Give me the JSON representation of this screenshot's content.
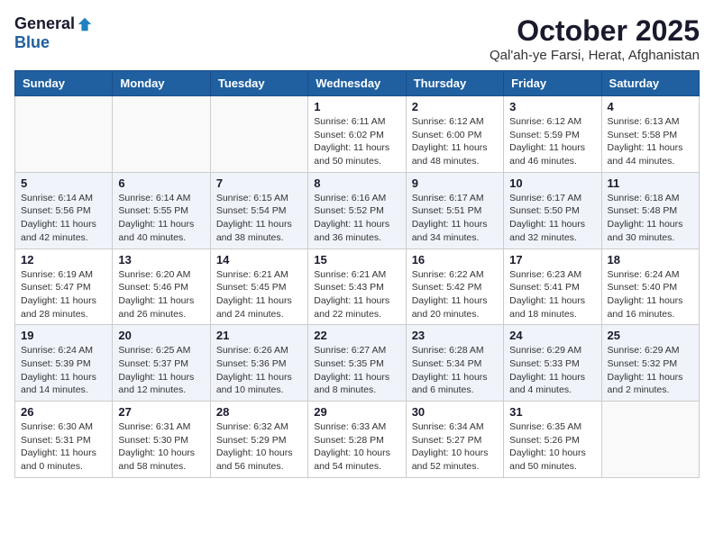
{
  "logo": {
    "general": "General",
    "blue": "Blue"
  },
  "title": "October 2025",
  "location": "Qal'ah-ye Farsi, Herat, Afghanistan",
  "weekdays": [
    "Sunday",
    "Monday",
    "Tuesday",
    "Wednesday",
    "Thursday",
    "Friday",
    "Saturday"
  ],
  "weeks": [
    [
      {
        "day": "",
        "info": ""
      },
      {
        "day": "",
        "info": ""
      },
      {
        "day": "",
        "info": ""
      },
      {
        "day": "1",
        "info": "Sunrise: 6:11 AM\nSunset: 6:02 PM\nDaylight: 11 hours\nand 50 minutes."
      },
      {
        "day": "2",
        "info": "Sunrise: 6:12 AM\nSunset: 6:00 PM\nDaylight: 11 hours\nand 48 minutes."
      },
      {
        "day": "3",
        "info": "Sunrise: 6:12 AM\nSunset: 5:59 PM\nDaylight: 11 hours\nand 46 minutes."
      },
      {
        "day": "4",
        "info": "Sunrise: 6:13 AM\nSunset: 5:58 PM\nDaylight: 11 hours\nand 44 minutes."
      }
    ],
    [
      {
        "day": "5",
        "info": "Sunrise: 6:14 AM\nSunset: 5:56 PM\nDaylight: 11 hours\nand 42 minutes."
      },
      {
        "day": "6",
        "info": "Sunrise: 6:14 AM\nSunset: 5:55 PM\nDaylight: 11 hours\nand 40 minutes."
      },
      {
        "day": "7",
        "info": "Sunrise: 6:15 AM\nSunset: 5:54 PM\nDaylight: 11 hours\nand 38 minutes."
      },
      {
        "day": "8",
        "info": "Sunrise: 6:16 AM\nSunset: 5:52 PM\nDaylight: 11 hours\nand 36 minutes."
      },
      {
        "day": "9",
        "info": "Sunrise: 6:17 AM\nSunset: 5:51 PM\nDaylight: 11 hours\nand 34 minutes."
      },
      {
        "day": "10",
        "info": "Sunrise: 6:17 AM\nSunset: 5:50 PM\nDaylight: 11 hours\nand 32 minutes."
      },
      {
        "day": "11",
        "info": "Sunrise: 6:18 AM\nSunset: 5:48 PM\nDaylight: 11 hours\nand 30 minutes."
      }
    ],
    [
      {
        "day": "12",
        "info": "Sunrise: 6:19 AM\nSunset: 5:47 PM\nDaylight: 11 hours\nand 28 minutes."
      },
      {
        "day": "13",
        "info": "Sunrise: 6:20 AM\nSunset: 5:46 PM\nDaylight: 11 hours\nand 26 minutes."
      },
      {
        "day": "14",
        "info": "Sunrise: 6:21 AM\nSunset: 5:45 PM\nDaylight: 11 hours\nand 24 minutes."
      },
      {
        "day": "15",
        "info": "Sunrise: 6:21 AM\nSunset: 5:43 PM\nDaylight: 11 hours\nand 22 minutes."
      },
      {
        "day": "16",
        "info": "Sunrise: 6:22 AM\nSunset: 5:42 PM\nDaylight: 11 hours\nand 20 minutes."
      },
      {
        "day": "17",
        "info": "Sunrise: 6:23 AM\nSunset: 5:41 PM\nDaylight: 11 hours\nand 18 minutes."
      },
      {
        "day": "18",
        "info": "Sunrise: 6:24 AM\nSunset: 5:40 PM\nDaylight: 11 hours\nand 16 minutes."
      }
    ],
    [
      {
        "day": "19",
        "info": "Sunrise: 6:24 AM\nSunset: 5:39 PM\nDaylight: 11 hours\nand 14 minutes."
      },
      {
        "day": "20",
        "info": "Sunrise: 6:25 AM\nSunset: 5:37 PM\nDaylight: 11 hours\nand 12 minutes."
      },
      {
        "day": "21",
        "info": "Sunrise: 6:26 AM\nSunset: 5:36 PM\nDaylight: 11 hours\nand 10 minutes."
      },
      {
        "day": "22",
        "info": "Sunrise: 6:27 AM\nSunset: 5:35 PM\nDaylight: 11 hours\nand 8 minutes."
      },
      {
        "day": "23",
        "info": "Sunrise: 6:28 AM\nSunset: 5:34 PM\nDaylight: 11 hours\nand 6 minutes."
      },
      {
        "day": "24",
        "info": "Sunrise: 6:29 AM\nSunset: 5:33 PM\nDaylight: 11 hours\nand 4 minutes."
      },
      {
        "day": "25",
        "info": "Sunrise: 6:29 AM\nSunset: 5:32 PM\nDaylight: 11 hours\nand 2 minutes."
      }
    ],
    [
      {
        "day": "26",
        "info": "Sunrise: 6:30 AM\nSunset: 5:31 PM\nDaylight: 11 hours\nand 0 minutes."
      },
      {
        "day": "27",
        "info": "Sunrise: 6:31 AM\nSunset: 5:30 PM\nDaylight: 10 hours\nand 58 minutes."
      },
      {
        "day": "28",
        "info": "Sunrise: 6:32 AM\nSunset: 5:29 PM\nDaylight: 10 hours\nand 56 minutes."
      },
      {
        "day": "29",
        "info": "Sunrise: 6:33 AM\nSunset: 5:28 PM\nDaylight: 10 hours\nand 54 minutes."
      },
      {
        "day": "30",
        "info": "Sunrise: 6:34 AM\nSunset: 5:27 PM\nDaylight: 10 hours\nand 52 minutes."
      },
      {
        "day": "31",
        "info": "Sunrise: 6:35 AM\nSunset: 5:26 PM\nDaylight: 10 hours\nand 50 minutes."
      },
      {
        "day": "",
        "info": ""
      }
    ]
  ]
}
